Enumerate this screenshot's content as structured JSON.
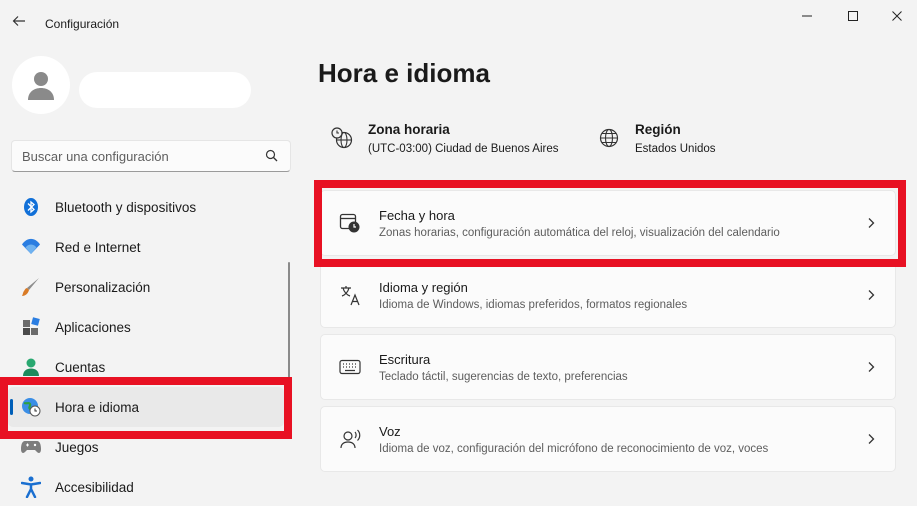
{
  "window": {
    "title": "Configuración"
  },
  "search": {
    "placeholder": "Buscar una configuración"
  },
  "sidebar": {
    "items": [
      {
        "label": "Bluetooth y dispositivos",
        "icon": "bluetooth-icon"
      },
      {
        "label": "Red e Internet",
        "icon": "wifi-icon"
      },
      {
        "label": "Personalización",
        "icon": "brush-icon"
      },
      {
        "label": "Aplicaciones",
        "icon": "apps-icon"
      },
      {
        "label": "Cuentas",
        "icon": "person-icon"
      },
      {
        "label": "Hora e idioma",
        "icon": "globe-clock-icon",
        "active": true
      },
      {
        "label": "Juegos",
        "icon": "gamepad-icon"
      },
      {
        "label": "Accesibilidad",
        "icon": "accessibility-icon"
      }
    ]
  },
  "main": {
    "title": "Hora e idioma",
    "quick_info": [
      {
        "title": "Zona horaria",
        "value": "(UTC-03:00) Ciudad de Buenos Aires",
        "icon": "globe-clock-icon"
      },
      {
        "title": "Región",
        "value": "Estados Unidos",
        "icon": "globe-icon"
      }
    ],
    "cards": [
      {
        "title": "Fecha y hora",
        "subtitle": "Zonas horarias, configuración automática del reloj, visualización del calendario",
        "icon": "calendar-clock-icon"
      },
      {
        "title": "Idioma y región",
        "subtitle": "Idioma de Windows, idiomas preferidos, formatos regionales",
        "icon": "language-icon"
      },
      {
        "title": "Escritura",
        "subtitle": "Teclado táctil, sugerencias de texto, preferencias",
        "icon": "keyboard-icon"
      },
      {
        "title": "Voz",
        "subtitle": "Idioma de voz, configuración del micrófono de reconocimiento de voz, voces",
        "icon": "speech-icon"
      }
    ]
  },
  "colors": {
    "accent": "#005fb8",
    "highlight": "#e81123"
  }
}
